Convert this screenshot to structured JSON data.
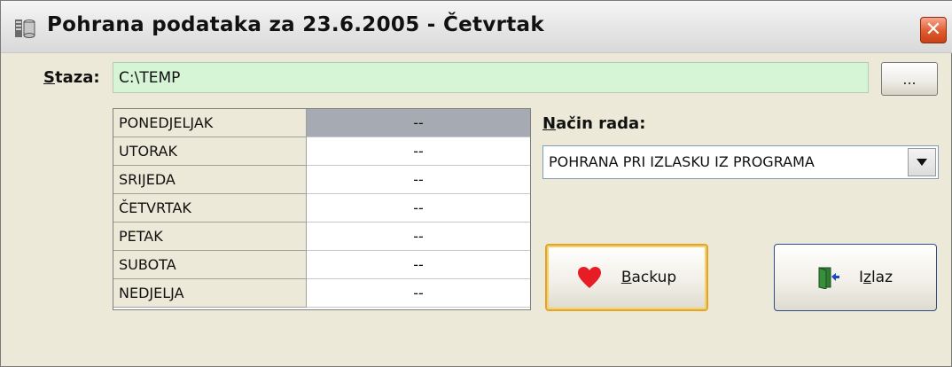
{
  "window": {
    "title": "Pohrana podataka za 23.6.2005 - Četvrtak",
    "close_label": "✕"
  },
  "path": {
    "label_prefix": "S",
    "label_rest": "taza:",
    "value": "C:\\TEMP",
    "browse_label": "..."
  },
  "days": [
    {
      "name": "PONEDJELJAK",
      "value": "--",
      "selected": true
    },
    {
      "name": "UTORAK",
      "value": "--"
    },
    {
      "name": "SRIJEDA",
      "value": "--"
    },
    {
      "name": "ČETVRTAK",
      "value": "--"
    },
    {
      "name": "PETAK",
      "value": "--"
    },
    {
      "name": "SUBOTA",
      "value": "--"
    },
    {
      "name": "NEDJELJA",
      "value": "--"
    }
  ],
  "mode": {
    "label_prefix": "N",
    "label_rest": "ačin rada:",
    "selected": "POHRANA PRI IZLASKU IZ PROGRAMA"
  },
  "buttons": {
    "backup_prefix": "B",
    "backup_rest": "ackup",
    "exit_prefix": "I",
    "exit_mid": "z",
    "exit_rest": "laz"
  },
  "colors": {
    "path_bg": "#d6f5d6",
    "selected_cell": "#a6aab3",
    "close_btn": "#e05a2c",
    "heart": "#e81c24"
  },
  "icons": {
    "app": "database-icon",
    "close": "close-icon",
    "backup": "heart-icon",
    "exit": "exit-door-icon",
    "dropdown": "chevron-down-icon"
  }
}
